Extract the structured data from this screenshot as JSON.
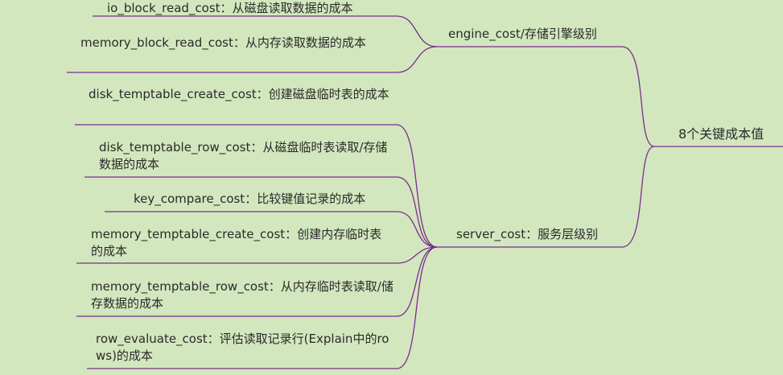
{
  "mindmap": {
    "root": {
      "text": "8个关键成本值"
    },
    "branches": [
      {
        "text": "engine_cost/存储引擎级别",
        "leaves": [
          {
            "text": "io_block_read_cost：从磁盘读取数据的成本"
          },
          {
            "text": "memory_block_read_cost：从内存读取数据的成本"
          }
        ]
      },
      {
        "text": "server_cost：服务层级别",
        "leaves": [
          {
            "text": "disk_temptable_create_cost：创建磁盘临时表的成本"
          },
          {
            "text": "disk_temptable_row_cost：从磁盘临时表读取/存储数据的成本"
          },
          {
            "text": "key_compare_cost：比较键值记录的成本"
          },
          {
            "text": "memory_temptable_create_cost：创建内存临时表的成本"
          },
          {
            "text": "memory_temptable_row_cost：从内存临时表读取/储存数据的成本"
          },
          {
            "text": "row_evaluate_cost：评估读取记录行(Explain中的rows)的成本"
          }
        ]
      }
    ]
  },
  "colors": {
    "background": "#d2e7be",
    "edge": "#7b2c8f",
    "text": "#2a2a2a"
  }
}
